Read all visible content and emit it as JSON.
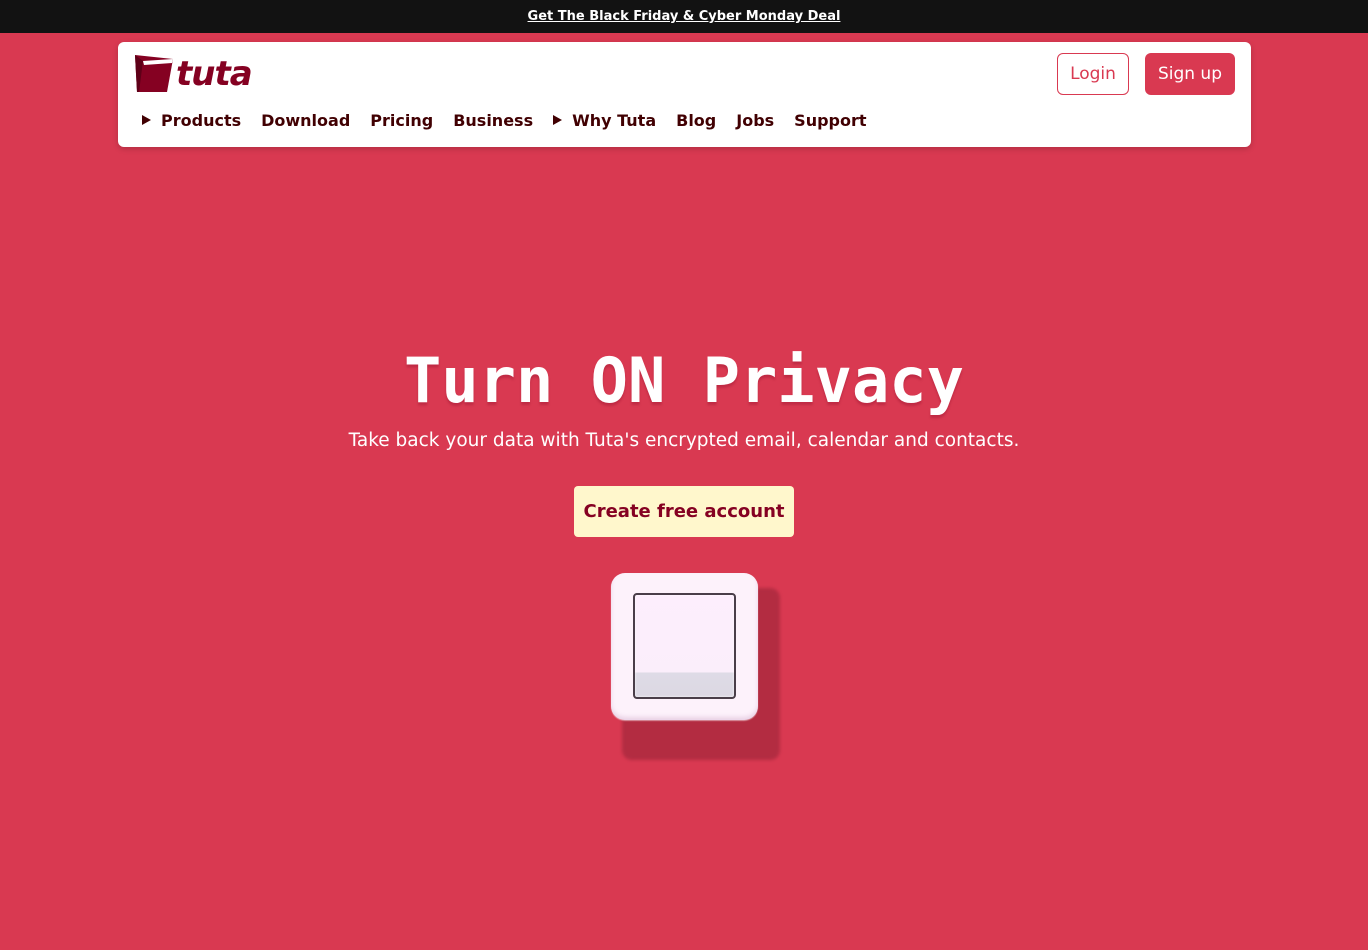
{
  "promo": {
    "text": "Get The Black Friday & Cyber Monday Deal"
  },
  "brand": {
    "name": "tuta",
    "color": "#850122",
    "accent": "#d93951"
  },
  "auth": {
    "login_label": "Login",
    "signup_label": "Sign up"
  },
  "nav": {
    "items": [
      {
        "label": "Products",
        "has_caret": true
      },
      {
        "label": "Download"
      },
      {
        "label": "Pricing"
      },
      {
        "label": "Business"
      },
      {
        "label": "Why Tuta",
        "has_caret": true
      },
      {
        "label": "Blog"
      },
      {
        "label": "Jobs"
      },
      {
        "label": "Support"
      }
    ]
  },
  "hero": {
    "title": "Turn ON Privacy",
    "subtitle": "Take back your data with Tuta's encrypted email, calendar and contacts.",
    "cta_label": "Create free account",
    "illustration": "light-switch-icon"
  },
  "colors": {
    "background": "#d93951",
    "promo_bar": "#121212",
    "cta_background": "#fff7cc",
    "nav_text": "#410002"
  }
}
